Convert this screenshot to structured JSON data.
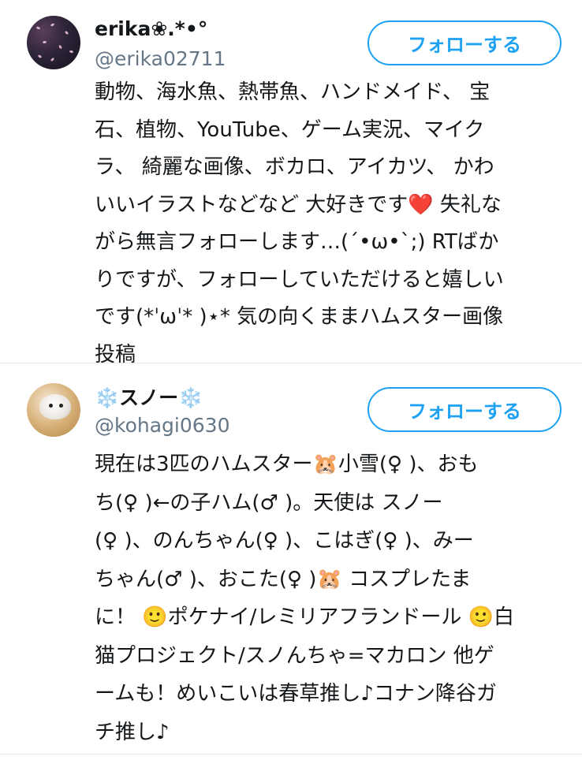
{
  "users": [
    {
      "display_name": "erika❀.*•°",
      "handle": "@erika02711",
      "follow_label": "フォローする",
      "bio": "動物、海水魚、熱帯魚、ハンドメイド、 宝\n石、植物、YouTube、ゲーム実況、マイク\nラ、 綺麗な画像、ボカロ、アイカツ、 かわ\nいいイラストなどなど 大好きです❤️ 失礼な\nがら無言フォローします…(´•ω•`;) RTばか\nりですが、フォローしていただけると嬉しい\nです(*ˈωˈ* )⋆* 気の向くままハムスター画像\n投稿"
    },
    {
      "display_name": "❄️スノー❄️",
      "handle": "@kohagi0630",
      "follow_label": "フォローする",
      "bio": "現在は3匹のハムスター🐹小雪(♀ )、おも\nち(♀ )←の子ハム(♂ )。天使は スノー\n(♀ )、のんちゃん(♀ )、こはぎ(♀ )、みー\nちゃん(♂ )、おこた(♀ )🐹 コスプレたま\nに！ 🙂ポケナイ/レミリアフランドール 🙂白\n猫プロジェクト/スノんちゃ=マカロン 他ゲ\nームも！めいこいは春草推し♪コナン降谷ガ\nチ推し♪"
    }
  ],
  "colors": {
    "accent": "#1da1f2",
    "handle": "#657786",
    "text": "#14171a",
    "divider": "#e1e8ed"
  }
}
